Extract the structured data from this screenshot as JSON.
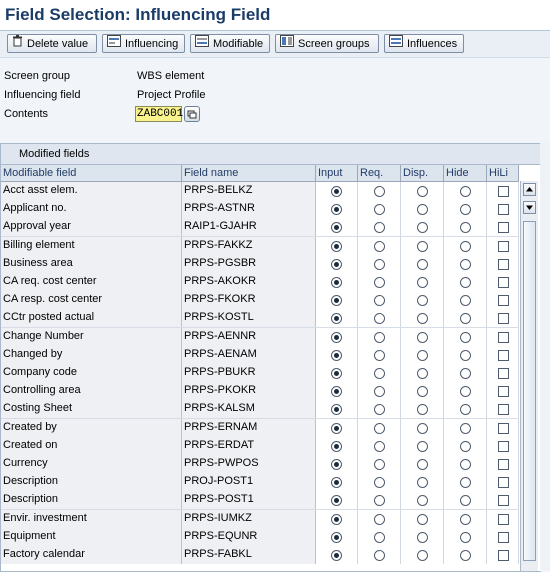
{
  "window": {
    "title": "Field Selection: Influencing Field"
  },
  "toolbar": {
    "buttons": [
      {
        "label": "Delete value",
        "icon": "trash-icon"
      },
      {
        "label": "Influencing",
        "icon": "influencing-icon"
      },
      {
        "label": "Modifiable",
        "icon": "modifiable-icon"
      },
      {
        "label": "Screen groups",
        "icon": "screen-groups-icon"
      },
      {
        "label": "Influences",
        "icon": "influences-icon"
      }
    ]
  },
  "form": {
    "screen_group_label": "Screen group",
    "screen_group_value": "WBS element",
    "influencing_field_label": "Influencing field",
    "influencing_field_value": "Project Profile",
    "contents_label": "Contents",
    "contents_value": "ZABC001"
  },
  "panel": {
    "title": "Modified fields",
    "columns": [
      "Modifiable field",
      "Field name",
      "Input",
      "Req.",
      "Disp.",
      "Hide",
      "HiLi"
    ],
    "rows": [
      {
        "modifiable": "Acct asst elem.",
        "field": "PRPS-BELKZ",
        "selected": "Input",
        "hili": false
      },
      {
        "modifiable": "Applicant no.",
        "field": "PRPS-ASTNR",
        "selected": "Input",
        "hili": false
      },
      {
        "modifiable": "Approval year",
        "field": "RAIP1-GJAHR",
        "selected": "Input",
        "hili": false
      },
      {
        "modifiable": "Billing element",
        "field": "PRPS-FAKKZ",
        "selected": "Input",
        "hili": false
      },
      {
        "modifiable": "Business area",
        "field": "PRPS-PGSBR",
        "selected": "Input",
        "hili": false
      },
      {
        "modifiable": "CA req. cost center",
        "field": "PRPS-AKOKR",
        "selected": "Input",
        "hili": false
      },
      {
        "modifiable": "CA resp. cost center",
        "field": "PRPS-FKOKR",
        "selected": "Input",
        "hili": false
      },
      {
        "modifiable": "CCtr posted actual",
        "field": "PRPS-KOSTL",
        "selected": "Input",
        "hili": false
      },
      {
        "modifiable": "Change Number",
        "field": "PRPS-AENNR",
        "selected": "Input",
        "hili": false
      },
      {
        "modifiable": "Changed by",
        "field": "PRPS-AENAM",
        "selected": "Input",
        "hili": false
      },
      {
        "modifiable": "Company code",
        "field": "PRPS-PBUKR",
        "selected": "Input",
        "hili": false
      },
      {
        "modifiable": "Controlling area",
        "field": "PRPS-PKOKR",
        "selected": "Input",
        "hili": false
      },
      {
        "modifiable": "Costing Sheet",
        "field": "PRPS-KALSM",
        "selected": "Input",
        "hili": false
      },
      {
        "modifiable": "Created by",
        "field": "PRPS-ERNAM",
        "selected": "Input",
        "hili": false
      },
      {
        "modifiable": "Created on",
        "field": "PRPS-ERDAT",
        "selected": "Input",
        "hili": false
      },
      {
        "modifiable": "Currency",
        "field": "PRPS-PWPOS",
        "selected": "Input",
        "hili": false
      },
      {
        "modifiable": "Description",
        "field": "PROJ-POST1",
        "selected": "Input",
        "hili": false
      },
      {
        "modifiable": "Description",
        "field": "PRPS-POST1",
        "selected": "Input",
        "hili": false
      },
      {
        "modifiable": "Envir. investment",
        "field": "PRPS-IUMKZ",
        "selected": "Input",
        "hili": false
      },
      {
        "modifiable": "Equipment",
        "field": "PRPS-EQUNR",
        "selected": "Input",
        "hili": false
      },
      {
        "modifiable": "Factory calendar",
        "field": "PRPS-FABKL",
        "selected": "Input",
        "hili": false
      }
    ]
  },
  "colors": {
    "title": "#1c3c68",
    "background": "#f1f4f9",
    "contents_input": "#f9f38d"
  }
}
